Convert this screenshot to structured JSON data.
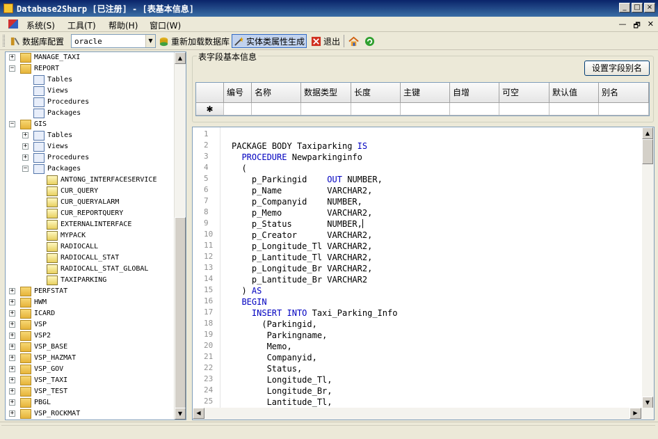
{
  "window": {
    "title": "Database2Sharp [已注册]  - [表基本信息]",
    "controls": [
      "_",
      "□",
      "×"
    ]
  },
  "menu": {
    "items": [
      "系统(S)",
      "工具(T)",
      "帮助(H)",
      "窗口(W)"
    ],
    "mdi_controls": [
      "—",
      "🗗",
      "✕"
    ]
  },
  "toolbar": {
    "db_config_label": "数据库配置",
    "db_select_value": "oracle",
    "reload_label": "重新加载数据库",
    "entity_gen_label": "实体类属性生成",
    "exit_label": "退出"
  },
  "tree": {
    "rows": [
      {
        "label": "MANAGE_TAXI",
        "level": 0,
        "icon": "folder-icon",
        "expander": "+"
      },
      {
        "label": "REPORT",
        "level": 0,
        "icon": "folder-icon",
        "expander": "−"
      },
      {
        "label": "Tables",
        "level": 1,
        "icon": "tables-icon",
        "expander": ""
      },
      {
        "label": "Views",
        "level": 1,
        "icon": "tables-icon",
        "expander": ""
      },
      {
        "label": "Procedures",
        "level": 1,
        "icon": "tables-icon",
        "expander": ""
      },
      {
        "label": "Packages",
        "level": 1,
        "icon": "tables-icon",
        "expander": ""
      },
      {
        "label": "GIS",
        "level": 0,
        "icon": "folder-icon",
        "expander": "−"
      },
      {
        "label": "Tables",
        "level": 1,
        "icon": "tables-icon",
        "expander": "+"
      },
      {
        "label": "Views",
        "level": 1,
        "icon": "tables-icon",
        "expander": "+"
      },
      {
        "label": "Procedures",
        "level": 1,
        "icon": "tables-icon",
        "expander": "+"
      },
      {
        "label": "Packages",
        "level": 1,
        "icon": "tables-icon",
        "expander": "−"
      },
      {
        "label": "ANTONG_INTERFACESERVICE",
        "level": 2,
        "icon": "package-icon",
        "expander": ""
      },
      {
        "label": "CUR_QUERY",
        "level": 2,
        "icon": "package-icon",
        "expander": ""
      },
      {
        "label": "CUR_QUERYALARM",
        "level": 2,
        "icon": "package-icon",
        "expander": ""
      },
      {
        "label": "CUR_REPORTQUERY",
        "level": 2,
        "icon": "package-icon",
        "expander": ""
      },
      {
        "label": "EXTERNALINTERFACE",
        "level": 2,
        "icon": "package-icon",
        "expander": ""
      },
      {
        "label": "MYPACK",
        "level": 2,
        "icon": "package-icon",
        "expander": ""
      },
      {
        "label": "RADIOCALL",
        "level": 2,
        "icon": "package-icon",
        "expander": ""
      },
      {
        "label": "RADIOCALL_STAT",
        "level": 2,
        "icon": "package-icon",
        "expander": ""
      },
      {
        "label": "RADIOCALL_STAT_GLOBAL",
        "level": 2,
        "icon": "package-icon",
        "expander": ""
      },
      {
        "label": "TAXIPARKING",
        "level": 2,
        "icon": "package-icon",
        "expander": ""
      },
      {
        "label": "PERFSTAT",
        "level": 0,
        "icon": "folder-icon",
        "expander": "+"
      },
      {
        "label": "HWM",
        "level": 0,
        "icon": "folder-icon",
        "expander": "+"
      },
      {
        "label": "ICARD",
        "level": 0,
        "icon": "folder-icon",
        "expander": "+"
      },
      {
        "label": "VSP",
        "level": 0,
        "icon": "folder-icon",
        "expander": "+"
      },
      {
        "label": "VSP2",
        "level": 0,
        "icon": "folder-icon",
        "expander": "+"
      },
      {
        "label": "VSP_BASE",
        "level": 0,
        "icon": "folder-icon",
        "expander": "+"
      },
      {
        "label": "VSP_HAZMAT",
        "level": 0,
        "icon": "folder-icon",
        "expander": "+"
      },
      {
        "label": "VSP_GOV",
        "level": 0,
        "icon": "folder-icon",
        "expander": "+"
      },
      {
        "label": "VSP_TAXI",
        "level": 0,
        "icon": "folder-icon",
        "expander": "+"
      },
      {
        "label": "VSP_TEST",
        "level": 0,
        "icon": "folder-icon",
        "expander": "+"
      },
      {
        "label": "PBGL",
        "level": 0,
        "icon": "folder-icon",
        "expander": "+"
      },
      {
        "label": "VSP_ROCKMAT",
        "level": 0,
        "icon": "folder-icon",
        "expander": "+"
      }
    ]
  },
  "field_info": {
    "group_title": "表字段基本信息",
    "alias_button": "设置字段别名",
    "columns": [
      "编号",
      "名称",
      "数据类型",
      "长度",
      "主键",
      "自增",
      "可空",
      "默认值",
      "别名"
    ],
    "new_row_marker": "✱"
  },
  "editor": {
    "lines": [
      "",
      "PACKAGE BODY Taxiparking IS",
      "  PROCEDURE Newparkinginfo",
      "  (",
      "    p_Parkingid    OUT NUMBER,",
      "    p_Name         VARCHAR2,",
      "    p_Companyid    NUMBER,",
      "    p_Memo         VARCHAR2,",
      "    p_Status       NUMBER,",
      "    p_Creator      VARCHAR2,",
      "    p_Longitude_Tl VARCHAR2,",
      "    p_Lantitude_Tl VARCHAR2,",
      "    p_Longitude_Br VARCHAR2,",
      "    p_Lantitude_Br VARCHAR2",
      "  ) AS",
      "  BEGIN",
      "    INSERT INTO Taxi_Parking_Info",
      "      (Parkingid,",
      "       Parkingname,",
      "       Memo,",
      "       Companyid,",
      "       Status,",
      "       Longitude_Tl,",
      "       Longitude_Br,",
      "       Lantitude_Tl,"
    ],
    "keywords": [
      "IS",
      "PROCEDURE",
      "OUT",
      "AS",
      "BEGIN",
      "INSERT",
      "INTO"
    ]
  }
}
